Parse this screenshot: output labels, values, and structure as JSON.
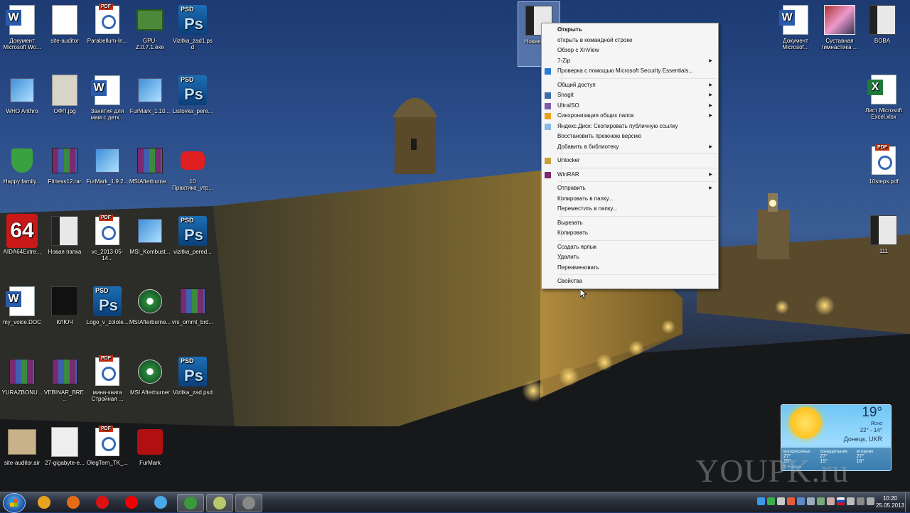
{
  "desktop_icons": [
    {
      "label": "Документ Microsoft Wo...",
      "type": "doc"
    },
    {
      "label": "site-auditor",
      "type": "cursor"
    },
    {
      "label": "Parabellum-In...",
      "type": "pdf"
    },
    {
      "label": "GPU-Z.0.7.1.exe",
      "type": "gpu"
    },
    {
      "label": "Vizitka_zad1.psd",
      "type": "psd"
    },
    {
      "label": "WHO Anthro",
      "type": "net"
    },
    {
      "label": "ОФП.jpg",
      "type": "jpg"
    },
    {
      "label": "Занятия для мам с детк...",
      "type": "doc"
    },
    {
      "label": "FurMark_1.10...",
      "type": "net"
    },
    {
      "label": "Listovka_pere...",
      "type": "psd"
    },
    {
      "label": "Happy family...",
      "type": "shield"
    },
    {
      "label": "Fitness12.rar",
      "type": "rar"
    },
    {
      "label": "FurMark_1.9.2...",
      "type": "net"
    },
    {
      "label": "MSIAfterburne...",
      "type": "rar"
    },
    {
      "label": "10 Практика_утр...",
      "type": "yt"
    },
    {
      "label": "AIDA64Extre...",
      "type": "aida"
    },
    {
      "label": "Новая папка",
      "type": "folder"
    },
    {
      "label": "vc_2013-05-14...",
      "type": "pdf"
    },
    {
      "label": "MSI_Kombust...",
      "type": "net"
    },
    {
      "label": "vizitka_pered...",
      "type": "psd"
    },
    {
      "label": "my_voice.DOC",
      "type": "doc"
    },
    {
      "label": "КЛЮЧ",
      "type": "key"
    },
    {
      "label": "Logo_v_zolote...",
      "type": "psd"
    },
    {
      "label": "MSIAfterburne...",
      "type": "msi"
    },
    {
      "label": "vrs_ornmt_brd...",
      "type": "rar"
    },
    {
      "label": "YURAZBONU...",
      "type": "rar"
    },
    {
      "label": "VEBINAR_BRE...",
      "type": "rar"
    },
    {
      "label": "мини-книга Стройная ...",
      "type": "pdf"
    },
    {
      "label": "MSI Afterburner",
      "type": "msi"
    },
    {
      "label": "Vizitka_zad.psd",
      "type": "psd"
    },
    {
      "label": "site-auditor.air",
      "type": "box"
    },
    {
      "label": "27-gigabyte-e...",
      "type": "mancharts"
    },
    {
      "label": "OlegTern_TK_...",
      "type": "pdf"
    },
    {
      "label": "FurMark",
      "type": "furmark"
    }
  ],
  "right_icons": [
    {
      "label": "Документ Microsof...",
      "type": "doc"
    },
    {
      "label": "Суставная гимнастика ...",
      "type": "photo"
    },
    {
      "label": "BOBA",
      "type": "folder"
    },
    {
      "label": "Лист Microsoft Excel.xlsx",
      "type": "xls"
    },
    {
      "label": "10steps.pdf",
      "type": "pdf"
    },
    {
      "label": "111",
      "type": "folder"
    }
  ],
  "selected_icon": {
    "label": "Новая па..."
  },
  "context_menu": {
    "items": [
      {
        "label": "Открыть",
        "bold": true,
        "submenu": false,
        "icon": ""
      },
      {
        "label": "открыть в командной строке",
        "submenu": false,
        "icon": ""
      },
      {
        "label": "Обзор с XnView",
        "submenu": false,
        "icon": ""
      },
      {
        "label": "7-Zip",
        "submenu": true,
        "icon": ""
      },
      {
        "label": "Проверка с помощью Microsoft Security Essentials...",
        "submenu": false,
        "icon": "mse-icon"
      },
      {
        "sep": true
      },
      {
        "label": "Общий доступ",
        "submenu": true,
        "icon": ""
      },
      {
        "label": "Snagit",
        "submenu": true,
        "icon": "snagit-icon"
      },
      {
        "label": "UltraISO",
        "submenu": true,
        "icon": "ultraiso-icon"
      },
      {
        "label": "Синхронизация общих папок",
        "submenu": true,
        "icon": "sync-icon"
      },
      {
        "label": "Яндекс.Диск: Скопировать публичную ссылку",
        "submenu": false,
        "icon": "yadisk-icon"
      },
      {
        "label": "Восстановить прежнюю версию",
        "submenu": false,
        "icon": ""
      },
      {
        "label": "Добавить в библиотеку",
        "submenu": true,
        "icon": ""
      },
      {
        "sep": true
      },
      {
        "label": "Unlocker",
        "submenu": false,
        "icon": "unlocker-icon"
      },
      {
        "sep": true
      },
      {
        "label": "WinRAR",
        "submenu": true,
        "icon": "winrar-icon"
      },
      {
        "sep": true
      },
      {
        "label": "Отправить",
        "submenu": true,
        "icon": ""
      },
      {
        "label": "Копировать в папку...",
        "submenu": false,
        "icon": ""
      },
      {
        "label": "Переместить в папку...",
        "submenu": false,
        "icon": ""
      },
      {
        "sep": true
      },
      {
        "label": "Вырезать",
        "submenu": false,
        "icon": ""
      },
      {
        "label": "Копировать",
        "submenu": false,
        "icon": ""
      },
      {
        "sep": true
      },
      {
        "label": "Создать ярлык",
        "submenu": false,
        "icon": ""
      },
      {
        "label": "Удалить",
        "submenu": false,
        "icon": ""
      },
      {
        "label": "Переименовать",
        "submenu": false,
        "icon": ""
      },
      {
        "sep": true
      },
      {
        "label": "Свойства",
        "submenu": false,
        "icon": ""
      }
    ],
    "submenu_arrow": "▶"
  },
  "weather": {
    "temp": "19°",
    "condition": "Ясно",
    "range": "22° - 14°",
    "location": "Донецк, UKR",
    "forecast": [
      {
        "day": "воскресенье",
        "hi": "27°",
        "lo": "15°"
      },
      {
        "day": "понедельник",
        "hi": "27°",
        "lo": "15°"
      },
      {
        "day": "вторник",
        "hi": "27°",
        "lo": "16°"
      }
    ],
    "source": "© Foreca"
  },
  "watermark": "YOUPK.ru",
  "taskbar": {
    "clock_time": "10:20",
    "clock_date": "25.05.2013",
    "pinned": [
      {
        "name": "chrome-alt-icon",
        "color": "#e8a21f"
      },
      {
        "name": "firefox-icon",
        "color": "#e66b17"
      },
      {
        "name": "opera-icon",
        "color": "#d11"
      },
      {
        "name": "yandex-browser-icon",
        "color": "#e00"
      },
      {
        "name": "ie-like-icon",
        "color": "#4aa8e8"
      },
      {
        "name": "chrome-icon",
        "color": "#3a9a3a"
      },
      {
        "name": "notes-icon",
        "color": "#b8c86a"
      },
      {
        "name": "explorer-icon",
        "color": "#888"
      }
    ]
  }
}
